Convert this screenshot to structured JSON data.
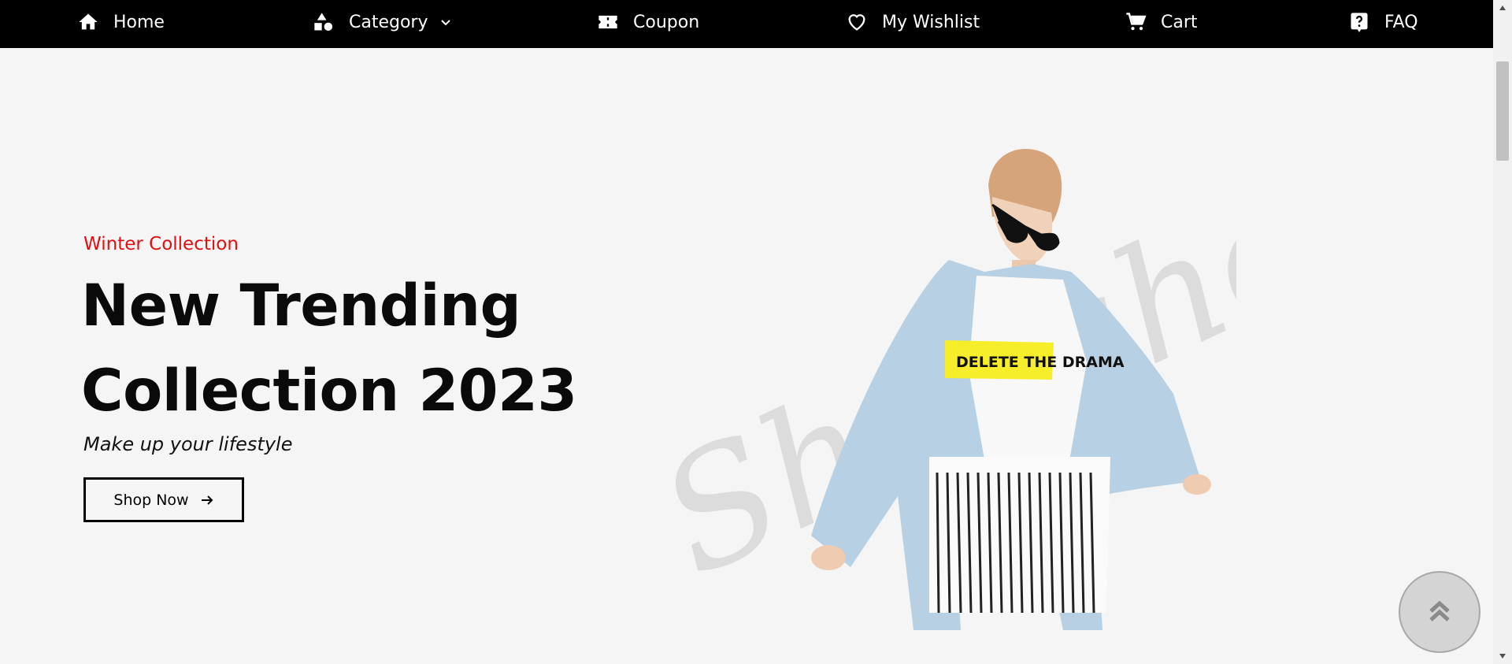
{
  "nav": {
    "items": [
      {
        "label": "Home",
        "icon": "home-icon"
      },
      {
        "label": "Category",
        "icon": "shapes-icon"
      },
      {
        "label": "Coupon",
        "icon": "ticket-icon"
      },
      {
        "label": "My Wishlist",
        "icon": "heart-icon"
      },
      {
        "label": "Cart",
        "icon": "cart-icon"
      },
      {
        "label": "FAQ",
        "icon": "question-icon"
      }
    ]
  },
  "hero": {
    "subtitle": "Winter Collection",
    "title_line1": "New Trending",
    "title_line2": "Collection 2023",
    "tagline": "Make up your lifestyle",
    "button_label": "Shop Now",
    "image_shirt_text": "DELETE THE DRAMA",
    "watermark_text": "Shopaholic"
  },
  "colors": {
    "accent": "#e01010",
    "nav_bg": "#000000",
    "page_bg": "#f5f5f5"
  }
}
